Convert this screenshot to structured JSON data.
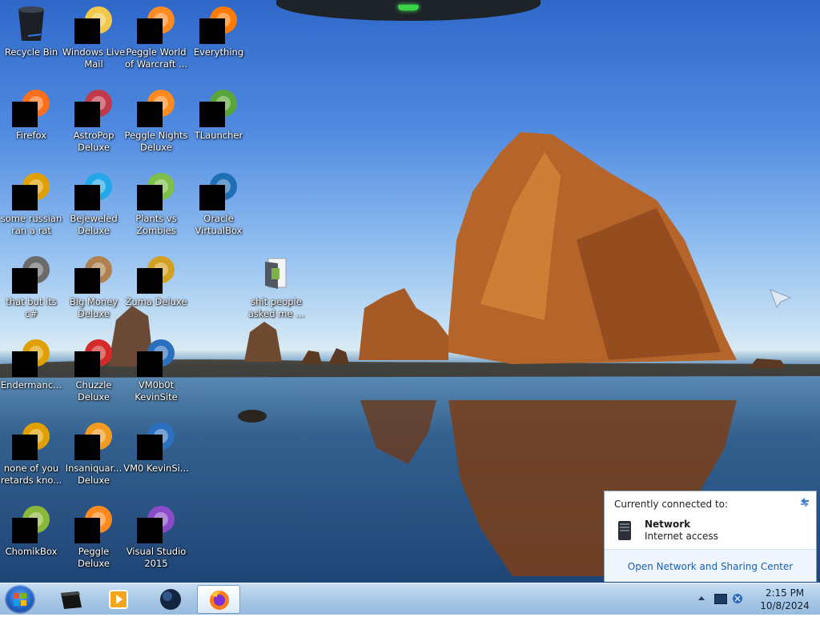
{
  "desktop_icons": [
    {
      "label": "Recycle Bin",
      "icon": "recycle-bin-icon",
      "redacted": false
    },
    {
      "label": "Windows Live Mail",
      "icon": "mail-icon",
      "redacted": true
    },
    {
      "label": "Peggle World of Warcraft ...",
      "icon": "peggle-icon",
      "redacted": true
    },
    {
      "label": "Everything",
      "icon": "search-magnifier-icon",
      "redacted": true
    },
    {
      "label": "Firefox",
      "icon": "firefox-icon",
      "redacted": true
    },
    {
      "label": "AstroPop Deluxe",
      "icon": "game-icon",
      "redacted": true
    },
    {
      "label": "Peggle Nights Deluxe",
      "icon": "peggle-icon",
      "redacted": true
    },
    {
      "label": "TLauncher",
      "icon": "grass-block-icon",
      "redacted": true
    },
    {
      "label": "some russian ran a rat",
      "icon": "app-icon",
      "redacted": true
    },
    {
      "label": "Bejeweled Deluxe",
      "icon": "gem-icon",
      "redacted": true
    },
    {
      "label": "Plants vs Zombies",
      "icon": "plant-icon",
      "redacted": true
    },
    {
      "label": "Oracle VirtualBox",
      "icon": "virtualbox-icon",
      "redacted": true
    },
    {
      "label": "that but its c#",
      "icon": "shortcut-icon",
      "redacted": true
    },
    {
      "label": "Big Money Deluxe",
      "icon": "money-bag-icon",
      "redacted": true
    },
    {
      "label": "Zuma Deluxe",
      "icon": "zuma-icon",
      "redacted": true
    },
    {
      "label": "shit people asked me ...",
      "icon": "folder-icon",
      "redacted": false
    },
    {
      "label": "Endermanc...",
      "icon": "app-icon",
      "redacted": true
    },
    {
      "label": "Chuzzle Deluxe",
      "icon": "chuzzle-icon",
      "redacted": true
    },
    {
      "label": "VM0b0t KevinSite",
      "icon": "vm-icon",
      "redacted": true
    },
    {
      "label": "none of you retards kno...",
      "icon": "app-icon",
      "redacted": true
    },
    {
      "label": "Insaniquar... Deluxe",
      "icon": "fish-icon",
      "redacted": true
    },
    {
      "label": "VM0 KevinSi...",
      "icon": "vm-icon",
      "redacted": true
    },
    {
      "label": "ChomikBox",
      "icon": "chomikbox-icon",
      "redacted": true
    },
    {
      "label": "Peggle Deluxe",
      "icon": "peggle-icon",
      "redacted": true
    },
    {
      "label": "Visual Studio 2015",
      "icon": "visual-studio-icon",
      "redacted": true
    }
  ],
  "taskbar": {
    "start_icon": "windows-start-icon",
    "pinned": [
      {
        "icon": "media-player-black-icon",
        "active": false
      },
      {
        "icon": "media-player-icon",
        "active": false
      },
      {
        "icon": "globe-icon",
        "active": false
      },
      {
        "icon": "firefox-icon",
        "active": true
      }
    ]
  },
  "tray": {
    "time": "2:15 PM",
    "date": "10/8/2024",
    "icons": [
      "show-hidden-icons-icon",
      "monitor-icon",
      "network-icon"
    ]
  },
  "network_flyout": {
    "title": "Currently connected to:",
    "network_name": "Network",
    "network_status": "Internet access",
    "link": "Open Network and Sharing Center",
    "colors": {
      "link": "#1a5fb4",
      "footer_bg": "#eef5fc"
    }
  }
}
